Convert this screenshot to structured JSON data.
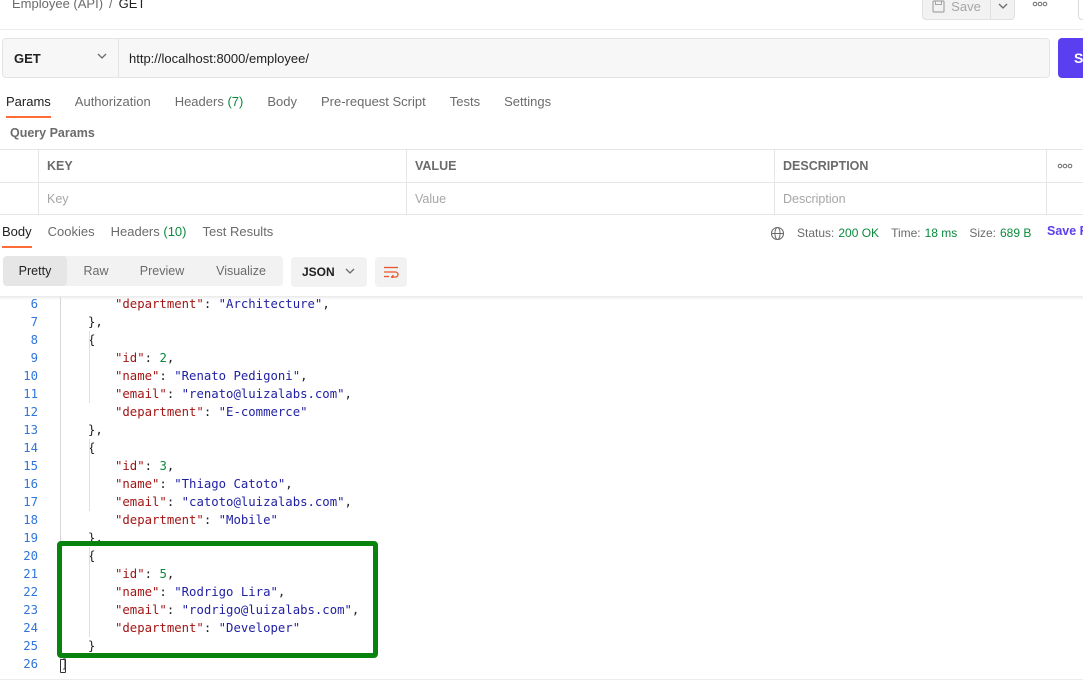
{
  "breadcrumb": {
    "collection": "Employee (API)",
    "separator": "/",
    "request": "GET"
  },
  "toolbar": {
    "save_label": "Save"
  },
  "request": {
    "method": "GET",
    "url": "http://localhost:8000/employee/",
    "send_label": "S"
  },
  "request_tabs": [
    {
      "label": "Params",
      "active": true
    },
    {
      "label": "Authorization"
    },
    {
      "label": "Headers",
      "count": "(7)"
    },
    {
      "label": "Body"
    },
    {
      "label": "Pre-request Script"
    },
    {
      "label": "Tests"
    },
    {
      "label": "Settings"
    }
  ],
  "query_params": {
    "title": "Query Params",
    "columns": [
      "KEY",
      "VALUE",
      "DESCRIPTION"
    ],
    "placeholders": [
      "Key",
      "Value",
      "Description"
    ]
  },
  "response_tabs": [
    {
      "label": "Body",
      "active": true
    },
    {
      "label": "Cookies"
    },
    {
      "label": "Headers",
      "count": "(10)"
    },
    {
      "label": "Test Results"
    }
  ],
  "response_meta": {
    "status_label": "Status:",
    "status": "200 OK",
    "time_label": "Time:",
    "time": "18 ms",
    "size_label": "Size:",
    "size": "689 B",
    "save_response": "Save R"
  },
  "view_modes": [
    "Pretty",
    "Raw",
    "Preview",
    "Visualize"
  ],
  "format": "JSON",
  "code_lines": [
    {
      "n": "6",
      "indent": 2,
      "key": "department",
      "str": "Architecture"
    },
    {
      "n": "7",
      "indent": 1,
      "raw": "},"
    },
    {
      "n": "8",
      "indent": 1,
      "raw": "{"
    },
    {
      "n": "9",
      "indent": 2,
      "key": "id",
      "num": "2"
    },
    {
      "n": "10",
      "indent": 2,
      "key": "name",
      "str": "Renato Pedigoni"
    },
    {
      "n": "11",
      "indent": 2,
      "key": "email",
      "str": "renato@luizalabs.com"
    },
    {
      "n": "12",
      "indent": 2,
      "key": "department",
      "str": "E-commerce",
      "last": true
    },
    {
      "n": "13",
      "indent": 1,
      "raw": "},"
    },
    {
      "n": "14",
      "indent": 1,
      "raw": "{"
    },
    {
      "n": "15",
      "indent": 2,
      "key": "id",
      "num": "3"
    },
    {
      "n": "16",
      "indent": 2,
      "key": "name",
      "str": "Thiago Catoto"
    },
    {
      "n": "17",
      "indent": 2,
      "key": "email",
      "str": "catoto@luizalabs.com"
    },
    {
      "n": "18",
      "indent": 2,
      "key": "department",
      "str": "Mobile",
      "last": true
    },
    {
      "n": "19",
      "indent": 1,
      "raw": "},"
    },
    {
      "n": "20",
      "indent": 1,
      "raw": "{"
    },
    {
      "n": "21",
      "indent": 2,
      "key": "id",
      "num": "5"
    },
    {
      "n": "22",
      "indent": 2,
      "key": "name",
      "str": "Rodrigo Lira"
    },
    {
      "n": "23",
      "indent": 2,
      "key": "email",
      "str": "rodrigo@luizalabs.com"
    },
    {
      "n": "24",
      "indent": 2,
      "key": "department",
      "str": "Developer",
      "last": true
    },
    {
      "n": "25",
      "indent": 1,
      "raw": "}"
    },
    {
      "n": "26",
      "indent": 0,
      "raw": "]"
    }
  ],
  "colors": {
    "accent": "#ff6c37",
    "send": "#5a3ff0",
    "status_ok": "#0b8a3c",
    "highlight_box": "#08830e"
  }
}
